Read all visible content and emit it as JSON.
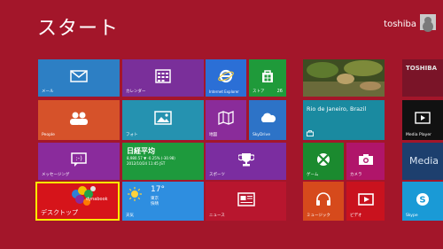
{
  "header": {
    "title": "スタート",
    "user_name": "toshiba"
  },
  "tiles": {
    "mail": {
      "label": "メール",
      "color": "#2d7fc4"
    },
    "calendar": {
      "label": "カレンダー",
      "color": "#7a2f9a"
    },
    "ie": {
      "label": "Internet Explorer",
      "color": "#2b6fd6"
    },
    "store": {
      "label": "ストア",
      "count": "26",
      "color": "#1f9a3a"
    },
    "people": {
      "label": "People",
      "color": "#d6522a"
    },
    "photos": {
      "label": "フォト",
      "color": "#2592b0"
    },
    "maps": {
      "label": "地図",
      "color": "#8a2c9a"
    },
    "skydrive": {
      "label": "SkyDrive",
      "color": "#2d73c7"
    },
    "messaging": {
      "label": "メッセージング",
      "color": "#8a2b9c"
    },
    "finance": {
      "title": "日経平均",
      "line1": "8,980.57 ▼ -0.25% (-30.98)",
      "line2": "2012/10/24 11:45 JST",
      "color": "#1e9a3d"
    },
    "sports": {
      "label": "スポーツ",
      "color": "#7b2da0"
    },
    "desktop": {
      "label": "デスクトップ",
      "brand": "dynabook",
      "color": "#d6141a",
      "highlight": "#ffea00"
    },
    "weather": {
      "temp": "17°",
      "city": "東京",
      "condition": "快晴",
      "label": "天気",
      "color": "#2e8ee0"
    },
    "news": {
      "label": "ニュース",
      "color": "#b8162e"
    },
    "travel": {
      "place": "Rio de Janeiro, Brazil",
      "color": "#1a8aa0"
    },
    "games": {
      "label": "ゲーム",
      "color": "#1b8a2f"
    },
    "camera": {
      "label": "カメラ",
      "color": "#b0156a"
    },
    "music": {
      "label": "ミュージック",
      "color": "#d64a1c"
    },
    "video": {
      "label": "ビデオ",
      "color": "#c9121e"
    },
    "toshiba_tile": {
      "label": "TOSHIBA",
      "color": "#7a1428"
    },
    "media_player": {
      "label": "Media Player",
      "color": "#111111"
    },
    "media_tile": {
      "label": "Media",
      "color": "#1d3f6e"
    },
    "skype": {
      "label": "Skype",
      "color": "#1a9ad6"
    }
  }
}
